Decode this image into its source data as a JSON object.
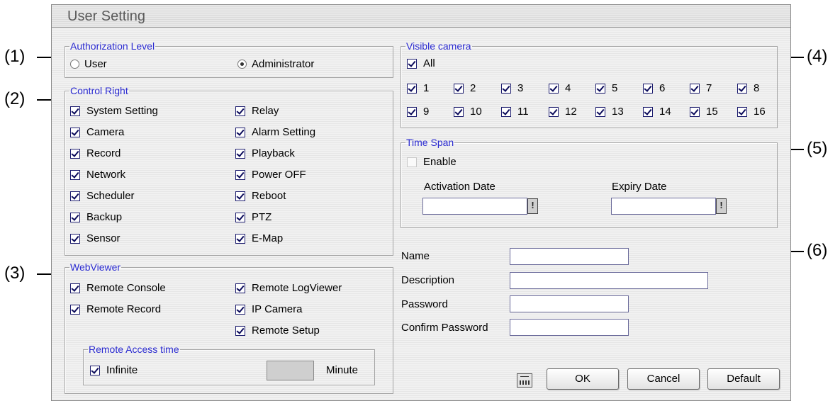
{
  "window": {
    "title": "User Setting"
  },
  "callouts": [
    "(1)",
    "(2)",
    "(3)",
    "(4)",
    "(5)",
    "(6)"
  ],
  "authorization": {
    "legend": "Authorization Level",
    "options": [
      {
        "label": "User",
        "selected": false
      },
      {
        "label": "Administrator",
        "selected": true
      }
    ]
  },
  "control_right": {
    "legend": "Control Right",
    "left": [
      {
        "label": "System Setting",
        "checked": true
      },
      {
        "label": "Camera",
        "checked": true
      },
      {
        "label": "Record",
        "checked": true
      },
      {
        "label": "Network",
        "checked": true
      },
      {
        "label": "Scheduler",
        "checked": true
      },
      {
        "label": "Backup",
        "checked": true
      },
      {
        "label": "Sensor",
        "checked": true
      }
    ],
    "right": [
      {
        "label": "Relay",
        "checked": true
      },
      {
        "label": "Alarm Setting",
        "checked": true
      },
      {
        "label": "Playback",
        "checked": true
      },
      {
        "label": "Power OFF",
        "checked": true
      },
      {
        "label": "Reboot",
        "checked": true
      },
      {
        "label": "PTZ",
        "checked": true
      },
      {
        "label": "E-Map",
        "checked": true
      }
    ]
  },
  "webviewer": {
    "legend": "WebViewer",
    "left": [
      {
        "label": "Remote Console",
        "checked": true
      },
      {
        "label": "Remote Record",
        "checked": true
      }
    ],
    "right": [
      {
        "label": "Remote LogViewer",
        "checked": true
      },
      {
        "label": "IP Camera",
        "checked": true
      },
      {
        "label": "Remote Setup",
        "checked": true
      }
    ],
    "remote_access": {
      "legend": "Remote Access time",
      "infinite_label": "Infinite",
      "infinite_checked": true,
      "minute_value": "",
      "minute_label": "Minute"
    }
  },
  "visible_camera": {
    "legend": "Visible camera",
    "all_label": "All",
    "all_checked": true,
    "cameras": [
      "1",
      "2",
      "3",
      "4",
      "5",
      "6",
      "7",
      "8",
      "9",
      "10",
      "11",
      "12",
      "13",
      "14",
      "15",
      "16"
    ]
  },
  "time_span": {
    "legend": "Time Span",
    "enable_label": "Enable",
    "enable_checked": false,
    "activation_label": "Activation Date",
    "activation_value": "",
    "expiry_label": "Expiry Date",
    "expiry_value": "",
    "picker_glyph": "!"
  },
  "account": {
    "name_label": "Name",
    "name_value": "",
    "description_label": "Description",
    "description_value": "",
    "password_label": "Password",
    "password_value": "",
    "confirm_label": "Confirm Password",
    "confirm_value": ""
  },
  "buttons": {
    "ok": "OK",
    "cancel": "Cancel",
    "default": "Default"
  },
  "icons": {
    "keyboard": "keyboard-icon"
  }
}
